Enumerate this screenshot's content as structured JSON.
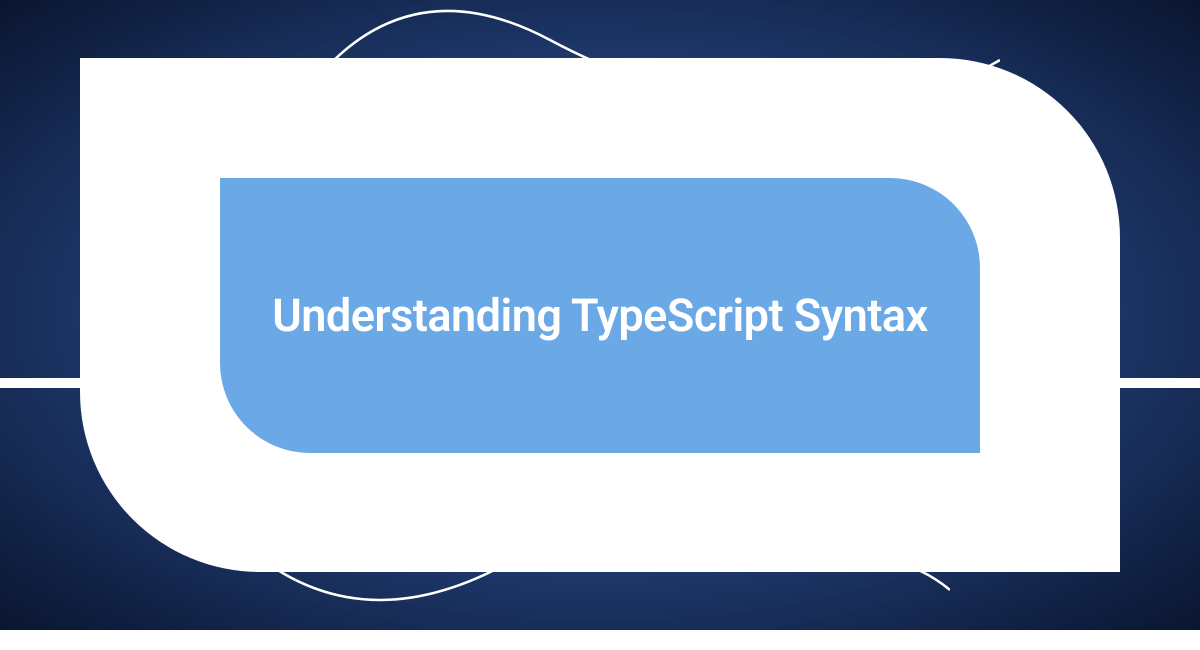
{
  "hero": {
    "title": "Understanding TypeScript Syntax"
  },
  "colors": {
    "background_gradient_center": "#5a93d8",
    "background_gradient_edge": "#0a1530",
    "outer_shape": "#ffffff",
    "inner_shape": "#6aa8e6",
    "title_text": "#ffffff",
    "wave_stroke": "#ffffff"
  }
}
